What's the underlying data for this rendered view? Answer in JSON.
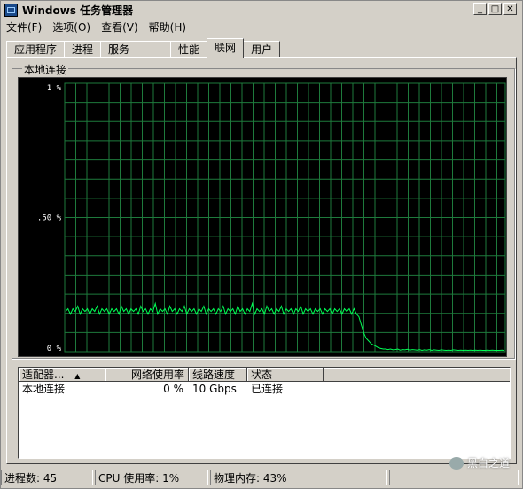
{
  "window": {
    "title": "Windows 任务管理器"
  },
  "menus": [
    "文件(F)",
    "选项(O)",
    "查看(V)",
    "帮助(H)"
  ],
  "tabs": [
    "应用程序",
    "进程",
    "服务",
    "性能",
    "联网",
    "用户"
  ],
  "active_tab": "联网",
  "graph": {
    "group_label": "本地连接",
    "y_labels": [
      "1 %",
      ".50 %",
      "0 %"
    ],
    "grid_color": "#1e7a3c",
    "line_color": "#00ff55"
  },
  "chart_data": {
    "type": "line",
    "title": "本地连接",
    "ylim": [
      0,
      1
    ],
    "y_ticks": [
      "1 %",
      ".50 %",
      "0 %"
    ],
    "series": [
      {
        "values": [
          0.15,
          0.16,
          0.14,
          0.16,
          0.15,
          0.17,
          0.14,
          0.16,
          0.15,
          0.16,
          0.14,
          0.16,
          0.15,
          0.17,
          0.14,
          0.16,
          0.15,
          0.16,
          0.14,
          0.16,
          0.15,
          0.16,
          0.14,
          0.17,
          0.15,
          0.16,
          0.14,
          0.16,
          0.15,
          0.16,
          0.14,
          0.17,
          0.15,
          0.16,
          0.14,
          0.16,
          0.15,
          0.18,
          0.14,
          0.16,
          0.15,
          0.16,
          0.14,
          0.17,
          0.15,
          0.16,
          0.14,
          0.16,
          0.15,
          0.17,
          0.14,
          0.16,
          0.15,
          0.16,
          0.14,
          0.16,
          0.15,
          0.17,
          0.14,
          0.16,
          0.15,
          0.16,
          0.14,
          0.16,
          0.15,
          0.17,
          0.14,
          0.16,
          0.15,
          0.16,
          0.14,
          0.17,
          0.15,
          0.16,
          0.14,
          0.16,
          0.15,
          0.18,
          0.14,
          0.16,
          0.15,
          0.16,
          0.14,
          0.17,
          0.15,
          0.16,
          0.14,
          0.16,
          0.15,
          0.17,
          0.14,
          0.16,
          0.15,
          0.16,
          0.14,
          0.16,
          0.15,
          0.17,
          0.14,
          0.16,
          0.15,
          0.16,
          0.14,
          0.16,
          0.15,
          0.16,
          0.14,
          0.16,
          0.15,
          0.16,
          0.14,
          0.16,
          0.15,
          0.16,
          0.14,
          0.16,
          0.15,
          0.16,
          0.14,
          0.16,
          0.14,
          0.13,
          0.1,
          0.07,
          0.05,
          0.04,
          0.03,
          0.025,
          0.02,
          0.015,
          0.012,
          0.01,
          0.01,
          0.008,
          0.01,
          0.007,
          0.008,
          0.01,
          0.006,
          0.008,
          0.007,
          0.009,
          0.006,
          0.008,
          0.007,
          0.006,
          0.008,
          0.005,
          0.007,
          0.006,
          0.008,
          0.005,
          0.007,
          0.006,
          0.005,
          0.007,
          0.006,
          0.005,
          0.006,
          0.005,
          0.007,
          0.006,
          0.005,
          0.006,
          0.005,
          0.006,
          0.005,
          0.006,
          0.005,
          0.006,
          0.005,
          0.006,
          0.005,
          0.005,
          0.006,
          0.005,
          0.006,
          0.005,
          0.005,
          0.005,
          0.006,
          0.005
        ]
      }
    ],
    "grid": true
  },
  "list": {
    "columns": [
      "适配器...",
      "网络使用率",
      "线路速度",
      "状态"
    ],
    "rows": [
      {
        "adapter": "本地连接",
        "usage": "0 %",
        "speed": "10 Gbps",
        "status": "已连接"
      }
    ]
  },
  "status": {
    "processes": "进程数: 45",
    "cpu": "CPU 使用率: 1%",
    "memory": "物理内存: 43%"
  },
  "watermark": "黑白之道",
  "sort_indicator": "▲"
}
